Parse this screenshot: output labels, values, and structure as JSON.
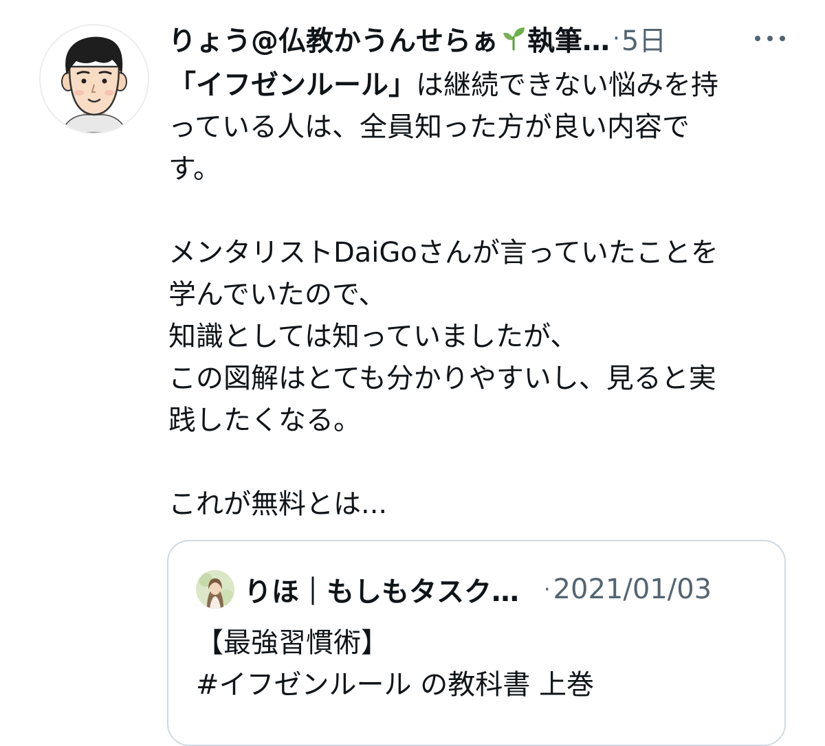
{
  "tweet": {
    "author_name": "りょう@仏教かうんせらぁ",
    "author_name_tail": "執筆…",
    "name_icon": "sprout-icon",
    "separator": "·",
    "time": "5日",
    "more_icon": "more-horizontal-icon",
    "avatar_icon": "avatar-illustration-icon",
    "text": {
      "line1_bold": "「イフゼンルール」",
      "line1_rest": "は継続できない悩みを持",
      "line2": "っている人は、全員知った方が良い内容で",
      "line3": "す。",
      "line4": "メンタリストDaiGoさんが言っていたことを",
      "line5": "学んでいたので、",
      "line6": "知識としては知っていましたが、",
      "line7": "この図解はとても分かりやすいし、見ると実",
      "line8": "践したくなる。",
      "line9": "これが無料とは..."
    }
  },
  "quoted_tweet": {
    "author_name": "りほ｜もしもタスク…",
    "separator": "·",
    "date": "2021/01/03",
    "line1": "【最強習慣術】",
    "line2": "#イフゼンルール の教科書 上巻"
  },
  "colors": {
    "text": "#0f1419",
    "secondary": "#536471",
    "border": "#cfd9de",
    "sprout_green": "#6ab04c"
  }
}
